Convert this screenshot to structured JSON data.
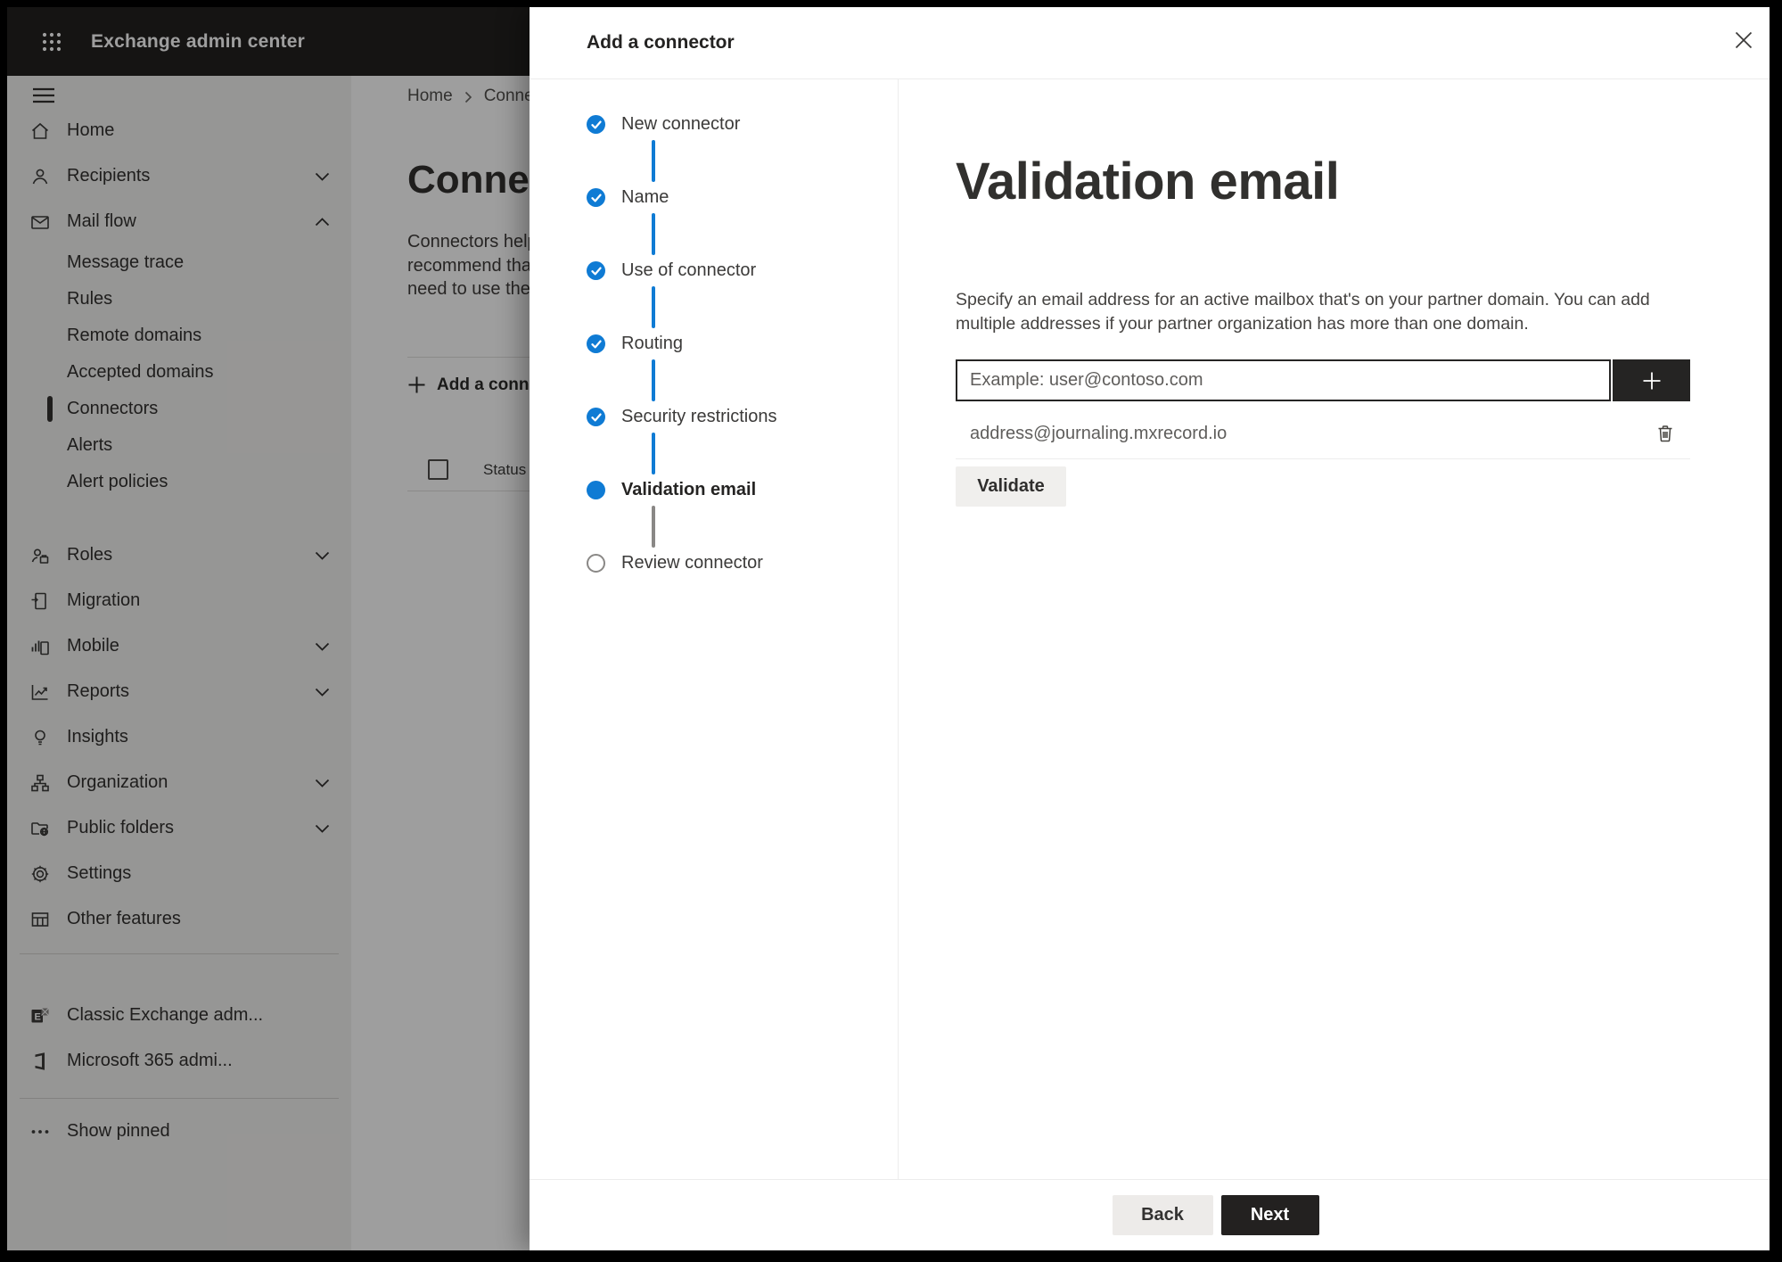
{
  "colors": {
    "accent": "#0078d4",
    "topbar_bg": "#222120",
    "sidebar_bg": "#f3f2f1",
    "dark_button": "#252423",
    "overlay": "rgba(0,0,0,0.38)"
  },
  "topbar": {
    "title": "Exchange admin center"
  },
  "sidebar": {
    "items": [
      {
        "label": "Home"
      },
      {
        "label": "Recipients"
      },
      {
        "label": "Mail flow"
      },
      {
        "label": "Message trace"
      },
      {
        "label": "Rules"
      },
      {
        "label": "Remote domains"
      },
      {
        "label": "Accepted domains"
      },
      {
        "label": "Connectors",
        "selected": true
      },
      {
        "label": "Alerts"
      },
      {
        "label": "Alert policies"
      },
      {
        "label": "Roles"
      },
      {
        "label": "Migration"
      },
      {
        "label": "Mobile"
      },
      {
        "label": "Reports"
      },
      {
        "label": "Insights"
      },
      {
        "label": "Organization"
      },
      {
        "label": "Public folders"
      },
      {
        "label": "Settings"
      },
      {
        "label": "Other features"
      },
      {
        "label": "Classic Exchange adm..."
      },
      {
        "label": "Microsoft 365 admi..."
      },
      {
        "label": "Show pinned"
      }
    ]
  },
  "background_page": {
    "breadcrumb": {
      "home": "Home",
      "current": "Connectors"
    },
    "heading": "Connectors",
    "description_lines": [
      "Connectors help",
      "recommend that",
      "need to use them"
    ],
    "add_button": "Add a connector",
    "table": {
      "column_status": "Status"
    }
  },
  "modal": {
    "title": "Add a connector",
    "steps": [
      {
        "label": "New connector",
        "state": "complete"
      },
      {
        "label": "Name",
        "state": "complete"
      },
      {
        "label": "Use of connector",
        "state": "complete"
      },
      {
        "label": "Routing",
        "state": "complete"
      },
      {
        "label": "Security restrictions",
        "state": "complete"
      },
      {
        "label": "Validation email",
        "state": "current"
      },
      {
        "label": "Review connector",
        "state": "upcoming"
      }
    ],
    "content": {
      "heading": "Validation email",
      "description": "Specify an email address for an active mailbox that's on your partner domain. You can add multiple addresses if your partner organization has more than one domain.",
      "input_placeholder": "Example: user@contoso.com",
      "addresses": [
        "address@journaling.mxrecord.io"
      ],
      "validate_button": "Validate"
    },
    "footer": {
      "back": "Back",
      "next": "Next"
    }
  }
}
